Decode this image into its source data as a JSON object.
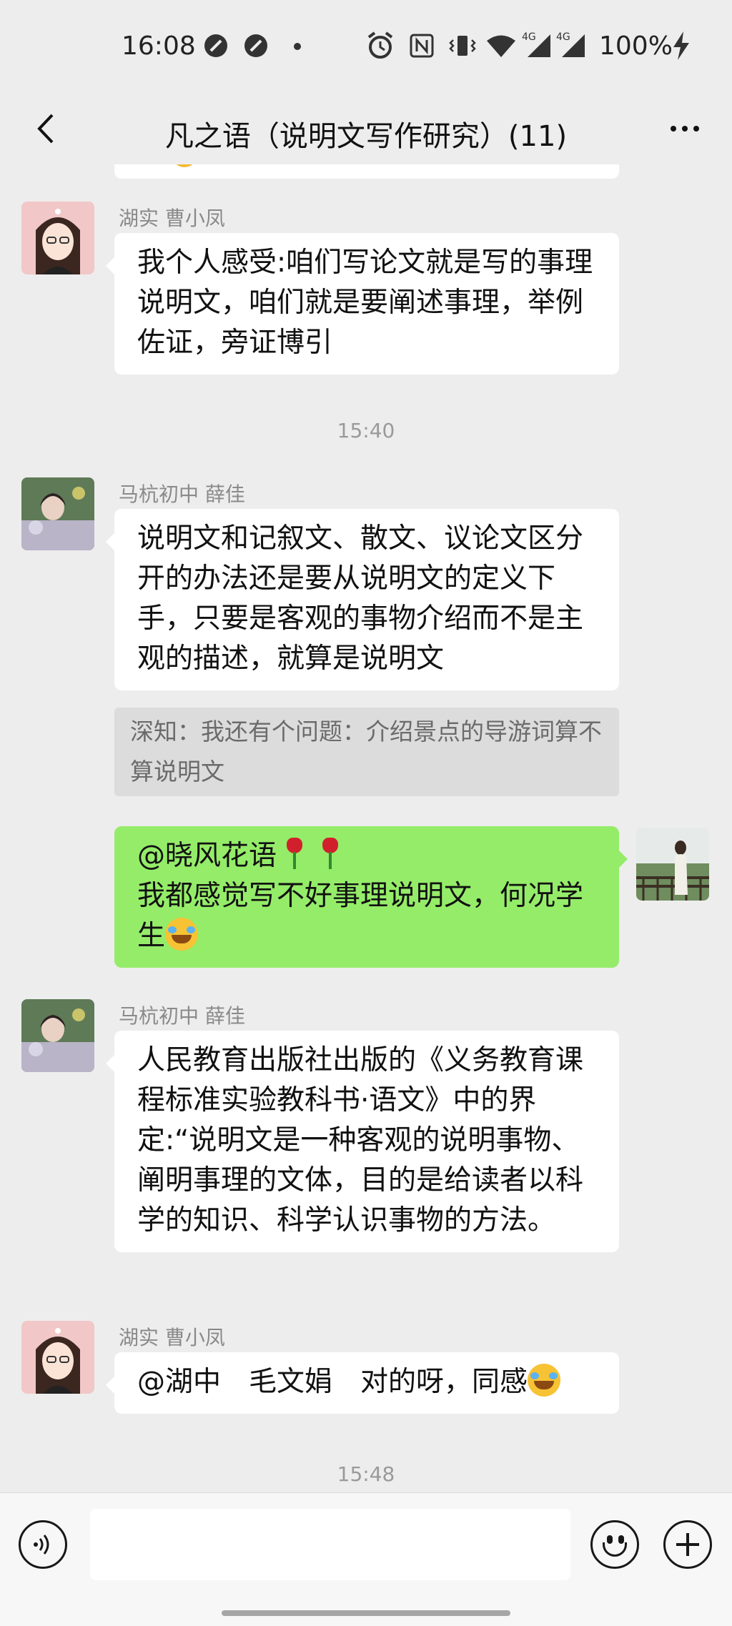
{
  "status_bar": {
    "time": "16:08",
    "battery": "100%",
    "icons": [
      "do-not-disturb-icon",
      "do-not-disturb-icon",
      "notification-dot-icon",
      "alarm-icon",
      "nfc-icon",
      "vibrate-icon",
      "wifi-icon",
      "signal-4g-icon",
      "signal-4g-icon",
      "charging-icon"
    ],
    "network_labels": [
      "4G",
      "4G"
    ]
  },
  "header": {
    "title": "凡之语（说明文写作研究）(11)"
  },
  "messages": [
    {
      "sender": "湖实 曹小凤",
      "text": "我个人感受:咱们写论文就是写的事理说明文，咱们就是要阐述事理，举例佐证，旁证博引"
    },
    {
      "timestamp": "15:40"
    },
    {
      "sender": "马杭初中 薛佳",
      "text": "说明文和记叙文、散文、议论文区分开的办法还是要从说明文的定义下手，只要是客观的事物介绍而不是主观的描述，就算是说明文",
      "quote": "深知：我还有个问题：介绍景点的导游词算不算说明文"
    },
    {
      "self": true,
      "line1": "@晓风花语",
      "line2": "我都感觉写不好事理说明文，何况学生"
    },
    {
      "sender": "马杭初中 薛佳",
      "text": "人民教育出版社出版的《义务教育课程标准实验教科书·语文》中的界定:“说明文是一种客观的说明事物、阐明事理的文体，目的是给读者以科学的知识、科学认识事物的方法。"
    },
    {
      "sender": "湖实 曹小凤",
      "text": "@湖中　毛文娟　对的呀，同感"
    },
    {
      "timestamp": "15:48"
    }
  ],
  "colors": {
    "background": "#ededed",
    "self_bubble": "#95ec69",
    "other_bubble": "#ffffff",
    "quote_bg": "#dcdcdc"
  }
}
